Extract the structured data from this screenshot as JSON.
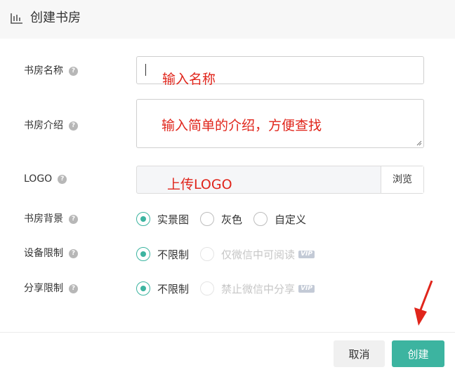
{
  "header": {
    "title": "创建书房",
    "icon": "bookshelf-icon"
  },
  "form": {
    "name": {
      "label": "书房名称",
      "annotation": "输入名称"
    },
    "intro": {
      "label": "书房介绍",
      "annotation": "输入简单的介绍，方便查找"
    },
    "logo": {
      "label": "LOGO",
      "annotation": "上传LOGO",
      "browse_label": "浏览"
    },
    "background": {
      "label": "书房背景",
      "options": [
        "实景图",
        "灰色",
        "自定义"
      ],
      "selected": "实景图"
    },
    "device_limit": {
      "label": "设备限制",
      "options": [
        "不限制",
        "仅微信中可阅读"
      ],
      "selected": "不限制",
      "vip_badge": "VIP"
    },
    "share_limit": {
      "label": "分享限制",
      "options": [
        "不限制",
        "禁止微信中分享"
      ],
      "selected": "不限制",
      "vip_badge": "VIP"
    },
    "help_glyph": "?"
  },
  "footer": {
    "cancel_label": "取消",
    "create_label": "创建"
  },
  "colors": {
    "accent": "#3cb4a0",
    "annotation": "#e0251b",
    "header_bg": "#f7f7f7"
  }
}
